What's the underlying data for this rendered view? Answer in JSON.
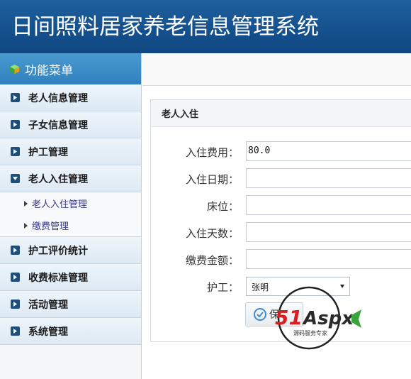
{
  "header": {
    "title": "日间照料居家养老信息管理系统"
  },
  "sidebar": {
    "head": "功能菜单",
    "items_top": [
      {
        "label": "老人信息管理"
      },
      {
        "label": "子女信息管理"
      },
      {
        "label": "护工管理"
      },
      {
        "label": "老人入住管理"
      }
    ],
    "submenu": [
      {
        "label": "老人入住管理"
      },
      {
        "label": "缴费管理"
      }
    ],
    "items_bottom": [
      {
        "label": "护工评价统计"
      },
      {
        "label": "收费标准管理"
      },
      {
        "label": "活动管理"
      },
      {
        "label": "系统管理"
      }
    ]
  },
  "panel": {
    "title": "老人入住",
    "fields": [
      {
        "label": "入住费用：",
        "value": "80.0"
      },
      {
        "label": "入住日期：",
        "value": ""
      },
      {
        "label": "床位：",
        "value": ""
      },
      {
        "label": "入住天数：",
        "value": ""
      },
      {
        "label": "缴费金额：",
        "value": ""
      }
    ],
    "nurse": {
      "label": "护工：",
      "value": "张明"
    },
    "save_label": "保"
  },
  "watermark": {
    "brand": "51Aspx",
    "tagline": "源码服务专家"
  },
  "colors": {
    "header": "#14508c",
    "menu_head": "#2f80bd",
    "arrow": "#1d4f7c"
  },
  "icons": {
    "menu_head": "cube-icon",
    "menu_item": "play-arrow-icon",
    "save": "check-circle-icon"
  }
}
